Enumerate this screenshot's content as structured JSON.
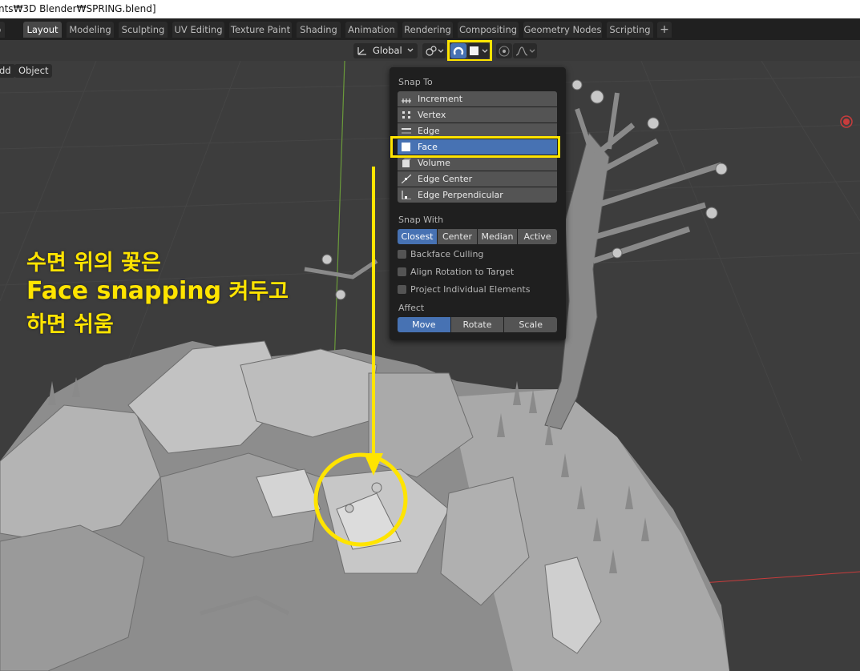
{
  "window": {
    "title": "nts₩3D Blender₩SPRING.blend]"
  },
  "tabs": [
    {
      "label": "p",
      "active": false
    },
    {
      "label": "Layout",
      "active": true
    },
    {
      "label": "Modeling",
      "active": false
    },
    {
      "label": "Sculpting",
      "active": false
    },
    {
      "label": "UV Editing",
      "active": false
    },
    {
      "label": "Texture Paint",
      "active": false
    },
    {
      "label": "Shading",
      "active": false
    },
    {
      "label": "Animation",
      "active": false
    },
    {
      "label": "Rendering",
      "active": false
    },
    {
      "label": "Compositing",
      "active": false
    },
    {
      "label": "Geometry Nodes",
      "active": false
    },
    {
      "label": "Scripting",
      "active": false
    }
  ],
  "add_workspace": {
    "label": "+"
  },
  "header": {
    "transform_orientation": "Global",
    "pivot_icon": "pivot-icon",
    "snap_icon": "magnet-icon",
    "snap_target_icon": "face-snap-icon",
    "proportional_icon": "proportional-edit-icon",
    "falloff_icon": "falloff-curve-icon"
  },
  "viewport_menu": [
    {
      "label": "dd"
    },
    {
      "label": "Object"
    }
  ],
  "snap_popover": {
    "snap_to_label": "Snap To",
    "snap_to_items": [
      {
        "label": "Increment",
        "icon": "increment-icon",
        "active": false
      },
      {
        "label": "Vertex",
        "icon": "vertex-icon",
        "active": false
      },
      {
        "label": "Edge",
        "icon": "edge-icon",
        "active": false
      },
      {
        "label": "Face",
        "icon": "face-icon",
        "active": true
      },
      {
        "label": "Volume",
        "icon": "volume-icon",
        "active": false
      },
      {
        "label": "Edge Center",
        "icon": "edge-center-icon",
        "active": false
      },
      {
        "label": "Edge Perpendicular",
        "icon": "edge-perpendicular-icon",
        "active": false
      }
    ],
    "snap_with_label": "Snap With",
    "snap_with_options": [
      {
        "label": "Closest",
        "active": true
      },
      {
        "label": "Center",
        "active": false
      },
      {
        "label": "Median",
        "active": false
      },
      {
        "label": "Active",
        "active": false
      }
    ],
    "checkboxes": [
      {
        "label": "Backface Culling",
        "checked": false
      },
      {
        "label": "Align Rotation to Target",
        "checked": false
      },
      {
        "label": "Project Individual Elements",
        "checked": false
      }
    ],
    "affect_label": "Affect",
    "affect_options": [
      {
        "label": "Move",
        "active": true
      },
      {
        "label": "Rotate",
        "active": false
      },
      {
        "label": "Scale",
        "active": false
      }
    ]
  },
  "annotation": {
    "line1": "수면 위의 꽃은",
    "line2_bold": "Face snapping",
    "line2_rest": " 켜두고",
    "line3": "하면 쉬움",
    "color": "#ffe400"
  },
  "colors": {
    "accent_blue": "#4772b3",
    "highlight_yellow": "#ffe400",
    "axis_red": "#c83c3c",
    "axis_green": "#6a9a3a"
  }
}
